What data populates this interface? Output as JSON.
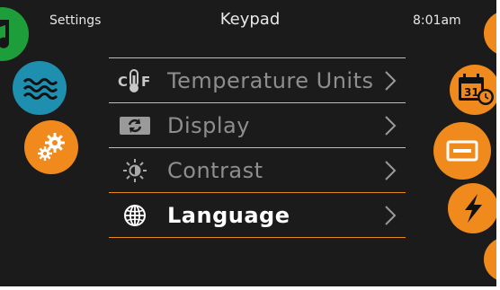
{
  "status_bar": {
    "left": "Settings",
    "title": "Keypad",
    "time": "8:01am"
  },
  "left_nav": [
    {
      "icon": "music-note-icon",
      "color": "#1e9e3a"
    },
    {
      "icon": "water-waves-icon",
      "color": "#1f8fb0"
    },
    {
      "icon": "gears-icon",
      "color": "#f08a1c"
    }
  ],
  "right_nav": [
    {
      "icon": "partial-orange-icon",
      "color": "#f08a1c"
    },
    {
      "icon": "calendar-clock-icon",
      "color": "#f08a1c",
      "calendar_text": "31"
    },
    {
      "icon": "display-rectangle-icon",
      "color": "#f08a1c"
    },
    {
      "icon": "lightning-icon",
      "color": "#f08a1c"
    },
    {
      "icon": "partial-orange-icon",
      "color": "#f08a1c"
    }
  ],
  "menu": {
    "items": [
      {
        "label": "Temperature Units",
        "icon": "thermometer-icon",
        "icon_text_c": "C",
        "icon_text_f": "F",
        "selected": false
      },
      {
        "label": "Display",
        "icon": "rotate-display-icon",
        "selected": false
      },
      {
        "label": "Contrast",
        "icon": "sun-contrast-icon",
        "selected": false
      },
      {
        "label": "Language",
        "icon": "globe-icon",
        "selected": true
      }
    ]
  },
  "colors": {
    "background": "#1b1b1b",
    "accent": "#e88a1a",
    "divider": "#bdbdbd",
    "inactive_text": "#8e8e8e",
    "active_text": "#ffffff"
  }
}
